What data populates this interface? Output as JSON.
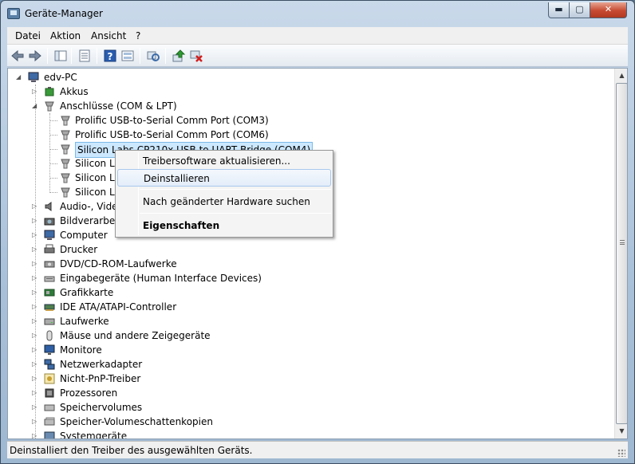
{
  "window": {
    "title": "Geräte-Manager",
    "buttons": {
      "minimize": "▬",
      "maximize": "▢",
      "close": "✕"
    }
  },
  "menu": [
    {
      "label": "Datei"
    },
    {
      "label": "Aktion"
    },
    {
      "label": "Ansicht"
    },
    {
      "label": "?"
    }
  ],
  "toolbar": {
    "icons": [
      "back-arrow-icon",
      "forward-arrow-icon",
      "tree-view-icon",
      "properties-icon",
      "help-icon",
      "show-list-icon",
      "scan-hardware-icon",
      "update-driver-icon",
      "uninstall-device-icon"
    ]
  },
  "tree": {
    "root": "edv-PC",
    "nodes": [
      {
        "label": "Akkus",
        "icon": "battery-icon",
        "expanded": false
      },
      {
        "label": "Anschlüsse (COM & LPT)",
        "icon": "port-icon",
        "expanded": true
      },
      {
        "label": "Prolific USB-to-Serial Comm Port (COM3)",
        "icon": "port-icon",
        "child": true
      },
      {
        "label": "Prolific USB-to-Serial Comm Port (COM6)",
        "icon": "port-icon",
        "child": true
      },
      {
        "label": "Silicon Labs CP210x USB to UART Bridge (COM4)",
        "icon": "port-icon",
        "child": true,
        "selected": true
      },
      {
        "label": "Silicon La",
        "icon": "port-icon",
        "child": true
      },
      {
        "label": "Silicon La",
        "icon": "port-icon",
        "child": true
      },
      {
        "label": "Silicon La",
        "icon": "port-icon",
        "child": true
      },
      {
        "label": "Audio-, Video",
        "icon": "speaker-icon",
        "expanded": false
      },
      {
        "label": "Bildverarbeitu",
        "icon": "camera-icon",
        "expanded": false
      },
      {
        "label": "Computer",
        "icon": "computer-icon",
        "expanded": false
      },
      {
        "label": "Drucker",
        "icon": "printer-icon",
        "expanded": false
      },
      {
        "label": "DVD/CD-ROM-Laufwerke",
        "icon": "disc-drive-icon",
        "expanded": false
      },
      {
        "label": "Eingabegeräte (Human Interface Devices)",
        "icon": "input-device-icon",
        "expanded": false
      },
      {
        "label": "Grafikkarte",
        "icon": "display-adapter-icon",
        "expanded": false
      },
      {
        "label": "IDE ATA/ATAPI-Controller",
        "icon": "ide-controller-icon",
        "expanded": false
      },
      {
        "label": "Laufwerke",
        "icon": "drive-icon",
        "expanded": false
      },
      {
        "label": "Mäuse und andere Zeigegeräte",
        "icon": "mouse-icon",
        "expanded": false
      },
      {
        "label": "Monitore",
        "icon": "monitor-icon",
        "expanded": false
      },
      {
        "label": "Netzwerkadapter",
        "icon": "network-icon",
        "expanded": false
      },
      {
        "label": "Nicht-PnP-Treiber",
        "icon": "non-pnp-icon",
        "expanded": false
      },
      {
        "label": "Prozessoren",
        "icon": "processor-icon",
        "expanded": false
      },
      {
        "label": "Speichervolumes",
        "icon": "storage-volume-icon",
        "expanded": false
      },
      {
        "label": "Speicher-Volumeschattenkopien",
        "icon": "shadow-copy-icon",
        "expanded": false
      },
      {
        "label": "Systemgeräte",
        "icon": "system-device-icon",
        "expanded": false
      }
    ]
  },
  "context_menu": {
    "items": [
      {
        "label": "Treibersoftware aktualisieren..."
      },
      {
        "label": "Deinstallieren",
        "highlighted": true
      },
      {
        "label": "Nach geänderter Hardware suchen"
      },
      {
        "label": "Eigenschaften",
        "bold": true
      }
    ]
  },
  "status": "Deinstalliert den Treiber des ausgewählten Geräts.",
  "colors": {
    "selection": "#cce8ff",
    "titlebar": "#b9cde2",
    "close": "#c74a31"
  }
}
